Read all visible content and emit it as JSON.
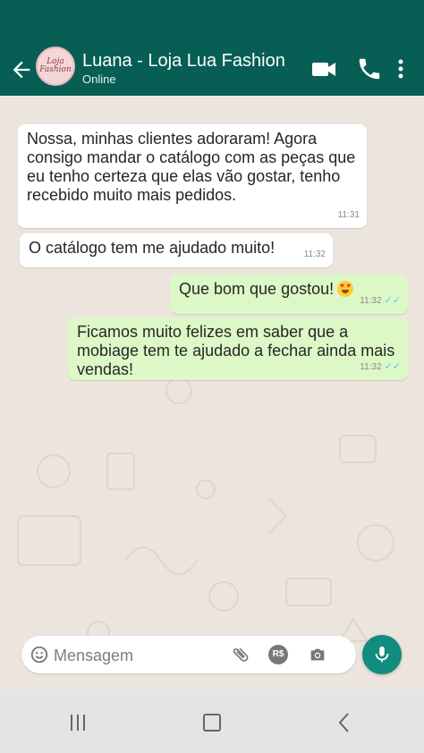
{
  "header": {
    "contact_name": "Luana - Loja Lua Fashion",
    "status": "Online",
    "avatar_text_1": "Loja",
    "avatar_text_2": "Fashion",
    "icons": [
      "back-arrow-icon",
      "video-call-icon",
      "phone-icon",
      "more-options-icon"
    ]
  },
  "messages": [
    {
      "direction": "incoming",
      "text": "Nossa, minhas clientes adoraram! Agora consigo mandar o catálogo com as peças que eu tenho certeza que elas vão gostar, tenho recebido muito mais pedidos.",
      "time": "11:31"
    },
    {
      "direction": "incoming",
      "text": "O catálogo tem me ajudado muito!",
      "time": "11:32"
    },
    {
      "direction": "outgoing",
      "text": "Que bom que gostou!",
      "emoji": "heart-eyes-emoji",
      "time": "11:32",
      "ticks": "✓✓"
    },
    {
      "direction": "outgoing",
      "text": "Ficamos muito felizes em saber que a mobiage tem te ajudado a fechar ainda mais vendas!",
      "time": "11:32",
      "ticks": "✓✓"
    }
  ],
  "composer": {
    "placeholder": "Mensagem",
    "currency_label": "R$",
    "icons": [
      "emoji-icon",
      "attach-icon",
      "currency-icon",
      "camera-icon",
      "microphone-icon"
    ]
  },
  "colors": {
    "header": "#075e54",
    "chat_background": "#ece5dd",
    "incoming_bubble": "#ffffff",
    "outgoing_bubble": "#dcf8c6",
    "accent": "#128c7e",
    "read_ticks": "#4fc3f7"
  },
  "system_nav": {
    "icons": [
      "recent-apps-icon",
      "home-icon",
      "back-icon"
    ]
  }
}
